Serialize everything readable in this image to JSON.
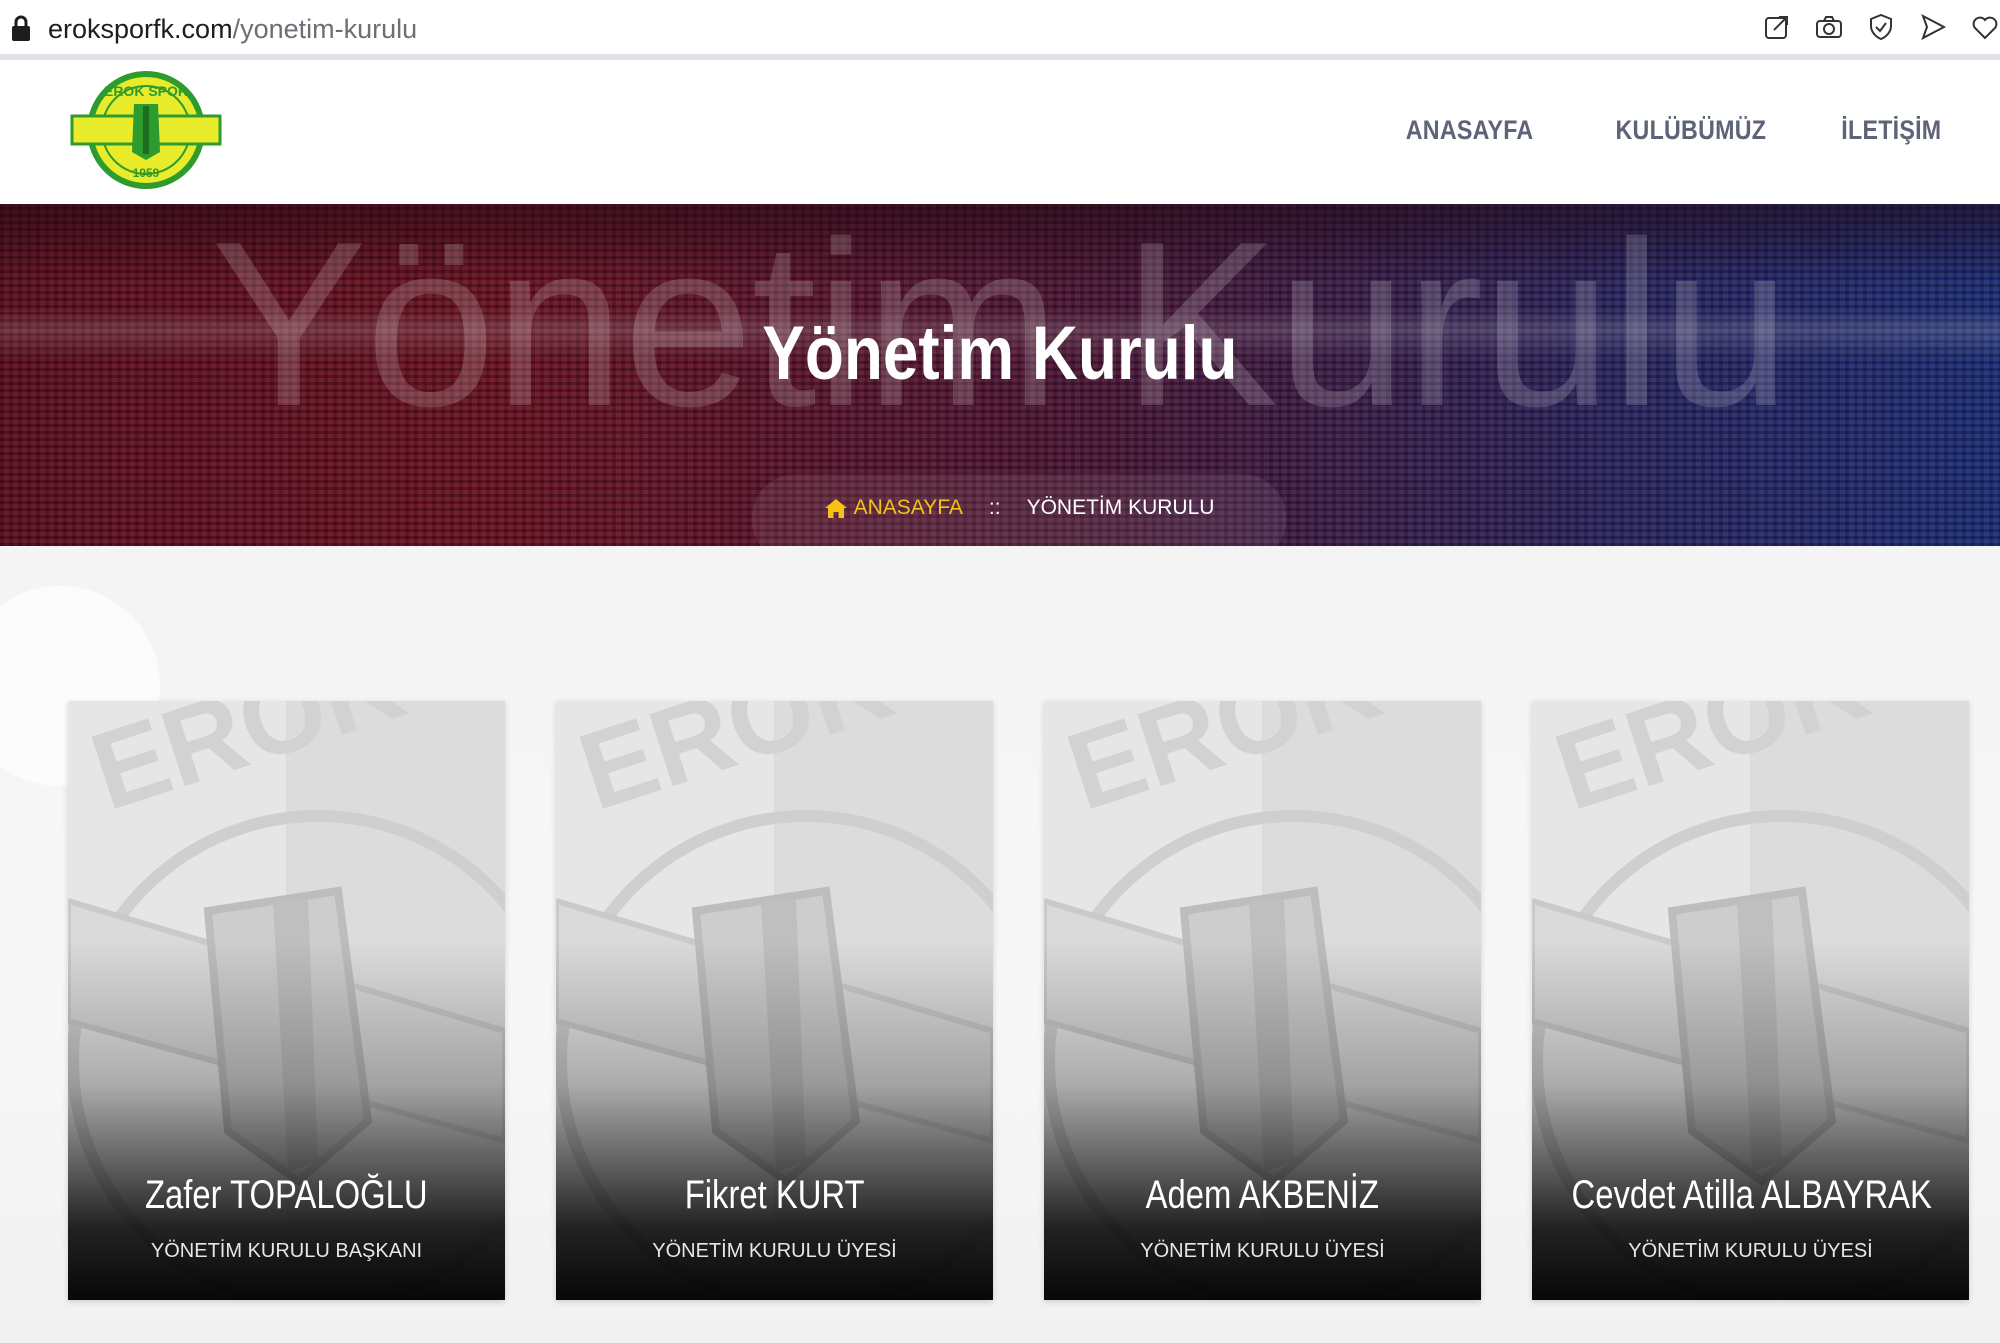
{
  "browser": {
    "url_domain": "eroksporfk.com",
    "url_path": "/yonetim-kurulu",
    "icons": [
      "share-icon",
      "camera-icon",
      "shield-icon",
      "send-icon",
      "heart-icon"
    ]
  },
  "header": {
    "logo_top_text": "EROK SPOR",
    "logo_year": "1959",
    "nav": [
      {
        "label": "ANASAYFA"
      },
      {
        "label": "KULÜBÜMÜZ"
      },
      {
        "label": "İLETİŞİM"
      }
    ]
  },
  "hero": {
    "ghost_text": "Yönetim Kurulu",
    "title": "Yönetim Kurulu",
    "breadcrumb": {
      "home": "ANASAYFA",
      "separator": "::",
      "current": "YÖNETİM KURULU"
    }
  },
  "members": [
    {
      "name": "Zafer TOPALOĞLU",
      "role": "YÖNETİM KURULU BAŞKANI"
    },
    {
      "name": "Fikret KURT",
      "role": "YÖNETİM KURULU ÜYESİ"
    },
    {
      "name": "Adem AKBENİZ",
      "role": "YÖNETİM KURULU ÜYESİ"
    },
    {
      "name": "Cevdet Atilla ALBAYRAK",
      "role": "YÖNETİM KURULU ÜYESİ"
    }
  ],
  "colors": {
    "accent_yellow": "#f3c316",
    "nav_text": "#5d6477",
    "logo_green": "#2e9b2e",
    "logo_yellow": "#e9ec2a"
  }
}
